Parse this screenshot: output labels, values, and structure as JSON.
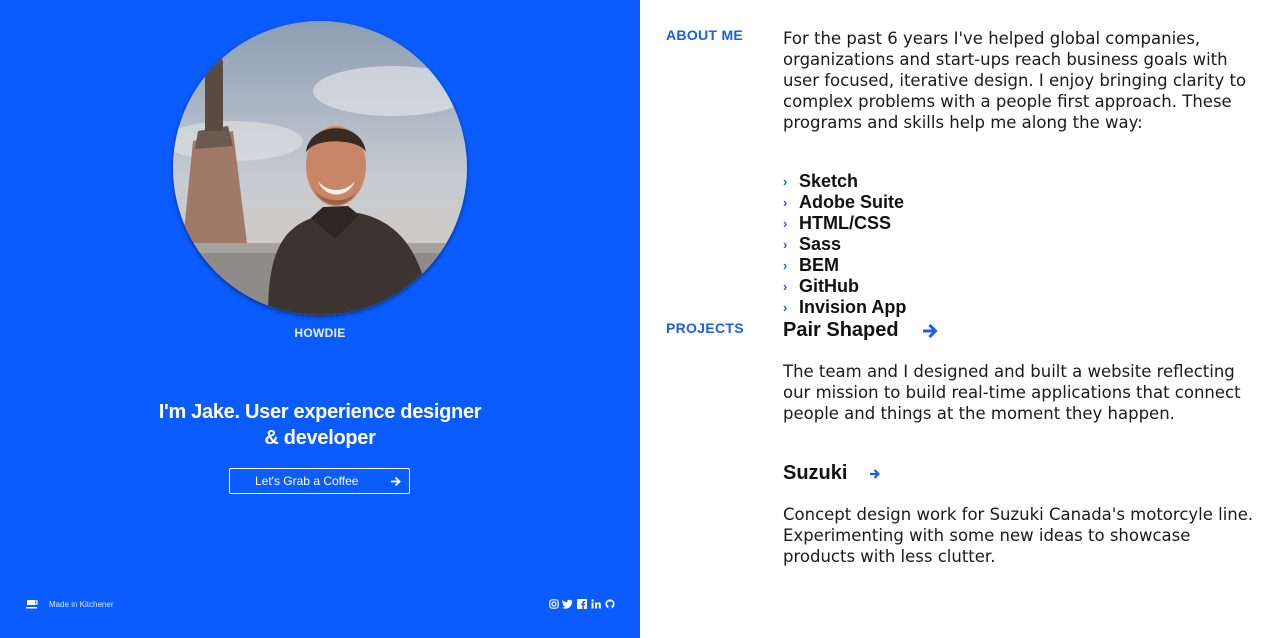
{
  "profile": {
    "greeting": "HOWDIE",
    "headline_line1": "I'm Jake. User experience designer",
    "headline_line2": "& developer",
    "cta_label": "Let's Grab a Coffee",
    "cta_icon": "arrow-right-icon"
  },
  "footer": {
    "made_in": "Made in Kitchener",
    "made_icon": "coffee-cup-icon",
    "socials": [
      "instagram-icon",
      "twitter-icon",
      "facebook-icon",
      "linkedin-icon",
      "github-icon"
    ]
  },
  "about": {
    "label": "ABOUT ME",
    "text": "For the past 6 years I've helped global companies, organizations and start-ups reach business goals with user focused, iterative design. I enjoy bringing clarity to complex problems with a people first approach. These programs and skills help me along the way:",
    "skills": [
      "Sketch",
      "Adobe Suite",
      "HTML/CSS",
      "Sass",
      "BEM",
      "GitHub",
      "Invision App"
    ]
  },
  "projects": {
    "label": "PROJECTS",
    "items": [
      {
        "title": "Pair Shaped",
        "description": "The team and I designed and built a website reflecting our mission to build real-time applications that connect people and things at the moment they happen."
      },
      {
        "title": "Suzuki",
        "description": "Concept design work for Suzuki Canada's motorcyle line. Experimenting with some new ideas to showcase products with less clutter."
      }
    ]
  },
  "colors": {
    "brand_blue": "#0a5cff",
    "accent_blue": "#1b5cf5",
    "text_dark": "#1a1a1a"
  }
}
